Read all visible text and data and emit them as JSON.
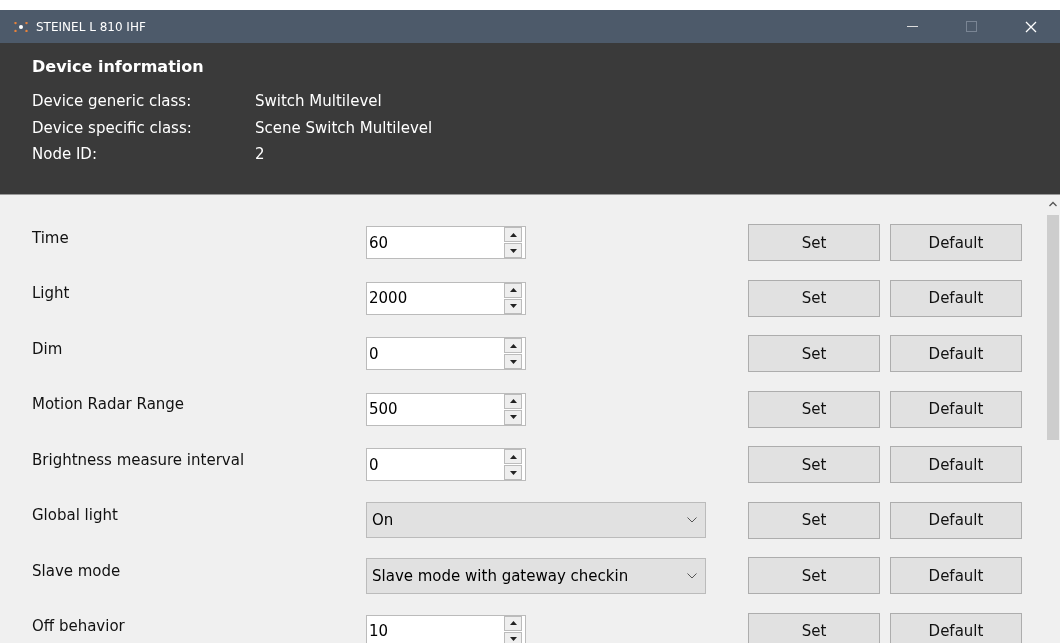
{
  "window": {
    "title": "STEINEL L 810 IHF"
  },
  "device_information": {
    "heading": "Device information",
    "rows": [
      {
        "label": "Device generic class:",
        "value": "Switch Multilevel"
      },
      {
        "label": "Device specific class:",
        "value": "Scene Switch Multilevel"
      },
      {
        "label": "Node ID:",
        "value": "2"
      }
    ]
  },
  "parameters": [
    {
      "label": "Time",
      "kind": "spin",
      "value": "60",
      "set": "Set",
      "default": "Default"
    },
    {
      "label": "Light",
      "kind": "spin",
      "value": "2000",
      "set": "Set",
      "default": "Default"
    },
    {
      "label": "Dim",
      "kind": "spin",
      "value": "0",
      "set": "Set",
      "default": "Default"
    },
    {
      "label": "Motion Radar Range",
      "kind": "spin",
      "value": "500",
      "set": "Set",
      "default": "Default"
    },
    {
      "label": "Brightness measure interval",
      "kind": "spin",
      "value": "0",
      "set": "Set",
      "default": "Default"
    },
    {
      "label": "Global light",
      "kind": "select",
      "value": "On",
      "set": "Set",
      "default": "Default"
    },
    {
      "label": "Slave mode",
      "kind": "select",
      "value": "Slave mode with gateway checkin",
      "set": "Set",
      "default": "Default"
    },
    {
      "label": "Off behavior",
      "kind": "spin",
      "value": "10",
      "set": "Set",
      "default": "Default"
    }
  ]
}
